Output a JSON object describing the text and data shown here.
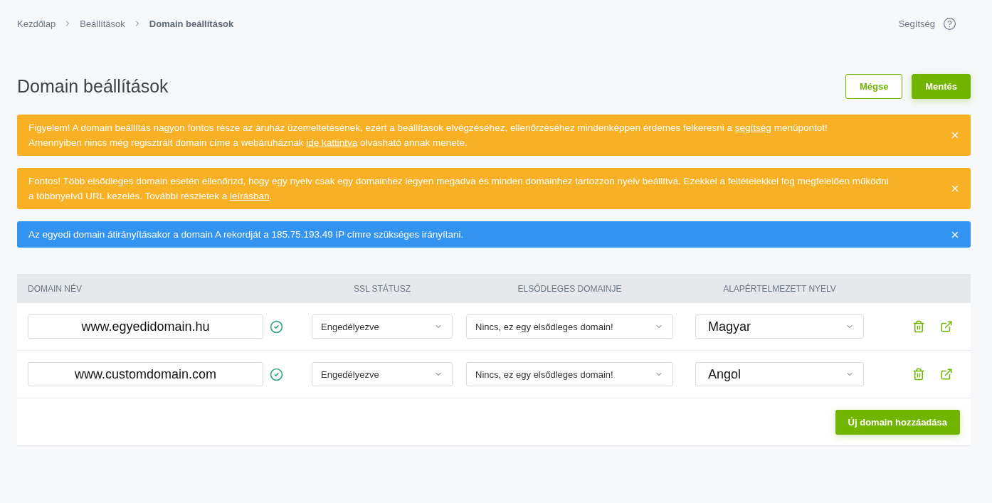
{
  "breadcrumb": [
    {
      "label": "Kezdőlap",
      "current": false
    },
    {
      "label": "Beállítások",
      "current": false
    },
    {
      "label": "Domain beállítások",
      "current": true
    }
  ],
  "help": {
    "label": "Segítség"
  },
  "page_title": "Domain beállítások",
  "actions": [
    {
      "label": "Mégse",
      "kind": "secondary"
    },
    {
      "label": "Mentés",
      "kind": "primary"
    }
  ],
  "alerts": [
    {
      "kind": "warning",
      "lines": [
        [
          {
            "kind": "text",
            "text": "Figyelem! A domain beállítás nagyon fontos része az áruház üzemeltetésének, ezért a beállítások elvégzéséhez, ellenőrzéséhez mindenképpen érdemes felkeresni a "
          },
          {
            "kind": "link",
            "text": "segítség"
          },
          {
            "kind": "text",
            "text": " menüpontot!"
          }
        ],
        [
          {
            "kind": "text",
            "text": "Amennyiben nincs még regisztrált domain címe a webáruháznak "
          },
          {
            "kind": "link",
            "text": "ide kattintva"
          },
          {
            "kind": "text",
            "text": " olvasható annak menete."
          }
        ]
      ]
    },
    {
      "kind": "warning",
      "lines": [
        [
          {
            "kind": "text",
            "text": "Fontos! Több elsődleges domain esetén ellenőrizd, hogy egy nyelv csak egy domainhez legyen megadva és minden domainhez tartozzon nyelv beállítva. Ezekkel a feltételekkel fog megfelelően működni"
          }
        ],
        [
          {
            "kind": "text",
            "text": "a többnyelvű URL kezelés. További részletek a "
          },
          {
            "kind": "link",
            "text": "leírásban"
          },
          {
            "kind": "text",
            "text": "."
          }
        ]
      ]
    },
    {
      "kind": "info",
      "lines": [
        [
          {
            "kind": "text",
            "text": "Az egyedi domain átirányításakor a domain A rekordját a 185.75.193.49 IP címre szükséges irányítani."
          }
        ]
      ]
    }
  ],
  "table": {
    "columns": [
      "DOMAIN NÉV",
      "SSL STÁTUSZ",
      "ELSŐDLEGES DOMAINJE",
      "ALAPÉRTELMEZETT NYELV"
    ],
    "rows": [
      {
        "domain": "www.egyedidomain.hu",
        "verified": true,
        "ssl_status": "Engedélyezve",
        "primary_domain": "Nincs, ez egy elsődleges domain!",
        "language": "Magyar"
      },
      {
        "domain": "www.customdomain.com",
        "verified": true,
        "ssl_status": "Engedélyezve",
        "primary_domain": "Nincs, ez egy elsődleges domain!",
        "language": "Angol"
      }
    ]
  },
  "add_button": {
    "label": "Új domain hozzáadása"
  }
}
